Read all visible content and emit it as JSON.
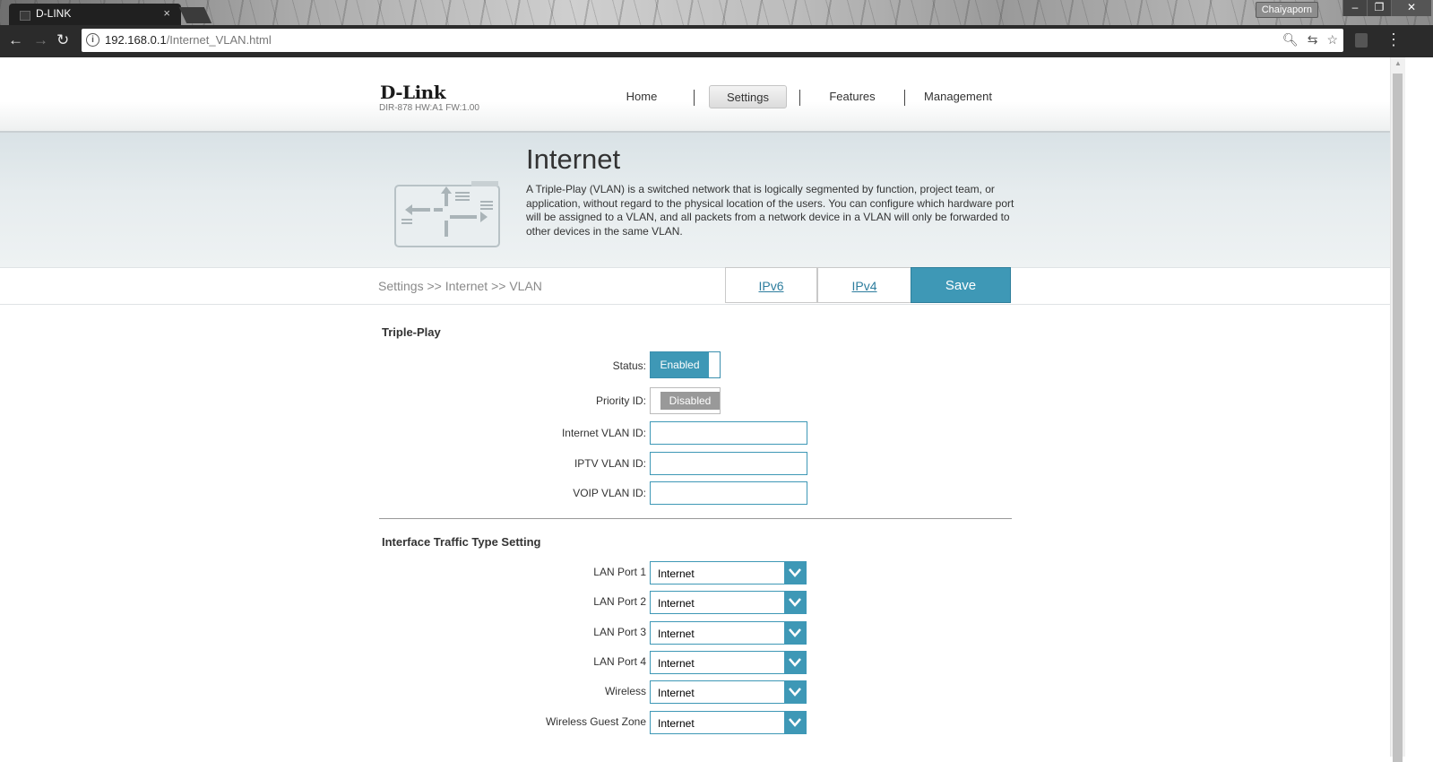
{
  "browser": {
    "tab_title": "D-LINK",
    "tab_close": "×",
    "user_name": "Chaiyaporn",
    "url_host": "192.168.0.1",
    "url_path": "/Internet_VLAN.html",
    "controls": {
      "minimize": "–",
      "restore": "❐",
      "close": "✕"
    }
  },
  "header": {
    "logo": "D-Link",
    "model": "DIR-878 HW:A1 FW:1.00",
    "nav": [
      {
        "label": "Home",
        "active": false
      },
      {
        "label": "Settings",
        "active": true
      },
      {
        "label": "Features",
        "active": false
      },
      {
        "label": "Management",
        "active": false
      }
    ]
  },
  "banner": {
    "title": "Internet",
    "description": "A Triple-Play (VLAN) is a switched network that is logically segmented by function, project team, or application, without regard to the physical location of the users. You can configure which hardware port will be assigned to a VLAN, and all packets from a network device in a VLAN will only be forwarded to other devices in the same VLAN."
  },
  "crumbs": {
    "breadcrumb": "Settings >> Internet >> VLAN",
    "ipv6": "IPv6",
    "ipv4": "IPv4",
    "save": "Save"
  },
  "triple_play": {
    "title": "Triple-Play",
    "status_label": "Status:",
    "status_value": "Enabled",
    "priority_label": "Priority ID:",
    "priority_value": "Disabled",
    "internet_vlan_label": "Internet VLAN ID:",
    "internet_vlan_value": "",
    "iptv_vlan_label": "IPTV VLAN ID:",
    "iptv_vlan_value": "",
    "voip_vlan_label": "VOIP VLAN ID:",
    "voip_vlan_value": ""
  },
  "traffic": {
    "title": "Interface Traffic Type Setting",
    "rows": [
      {
        "label": "LAN Port 1",
        "value": "Internet"
      },
      {
        "label": "LAN Port 2",
        "value": "Internet"
      },
      {
        "label": "LAN Port 3",
        "value": "Internet"
      },
      {
        "label": "LAN Port 4",
        "value": "Internet"
      },
      {
        "label": "Wireless",
        "value": "Internet"
      },
      {
        "label": "Wireless Guest Zone",
        "value": "Internet"
      }
    ]
  },
  "colors": {
    "accent": "#3e98b6",
    "disabled": "#999999"
  }
}
